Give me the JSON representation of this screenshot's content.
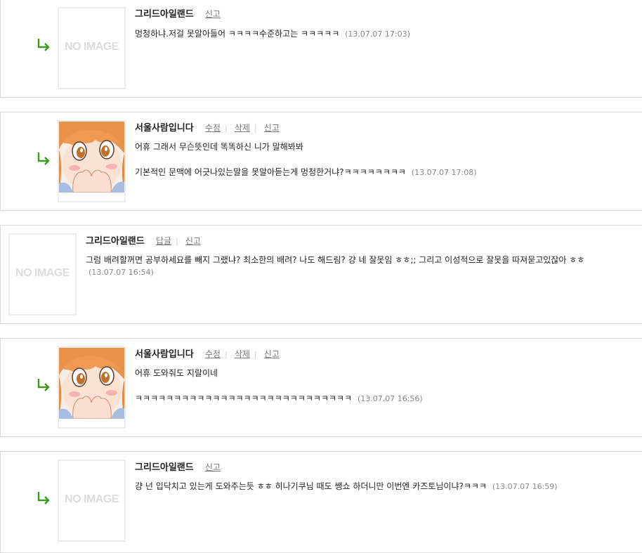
{
  "comments": [
    {
      "author": "그리드아일랜드",
      "actions": [
        "신고"
      ],
      "lines": [
        "멍청하냐.저걸 못알아들어 ㅋㅋㅋㅋ수준하고는 ㅋㅋㅋㅋㅋ"
      ],
      "timestamp": "(13.07.07 17:03)",
      "avatar": "no-image"
    },
    {
      "author": "서울사람입니다",
      "actions": [
        "수정",
        "삭제",
        "신고"
      ],
      "lines": [
        "어휴 그래서 무슨뜻인데 똑똑하신 니가 말해봐봐",
        "기본적인 문맥에 어긋나있는말을 못알아듣는게 멍청한거냐?ㅋㅋㅋㅋㅋㅋㅋㅋ"
      ],
      "timestamp": "(13.07.07 17:08)",
      "avatar": "anime-girl"
    },
    {
      "author": "그리드아일랜드",
      "actions": [
        "답글",
        "신고"
      ],
      "lines": [
        "그럼 배려할꺼면 공부하세요를 빼지 그랬냐? 최소한의 배려?  나도 해드림? 걍 네 잘못임 ㅎㅎ;; 그리고 이성적으로 잘못을 따져묻고있잖아 ㅎㅎ"
      ],
      "timestamp": "(13.07.07 16:54)",
      "avatar": "no-image"
    },
    {
      "author": "서울사람입니다",
      "actions": [
        "수정",
        "삭제",
        "신고"
      ],
      "lines": [
        "어휴 도와줘도 지랄이네",
        "ㅋㅋㅋㅋㅋㅋㅋㅋㅋㅋㅋㅋㅋㅋㅋㅋㅋㅋㅋㅋㅋㅋㅋㅋㅋㅋㅋㅋ"
      ],
      "timestamp": "(13.07.07 16:56)",
      "avatar": "anime-girl"
    },
    {
      "author": "그리드아일랜드",
      "actions": [
        "신고"
      ],
      "lines": [
        "걍 넌 입닥치고 있는게 도와주는듯 ㅎㅎ 히나기쿠님 때도 쌩쇼 하더니만 이번엔 카즈토님이냐?ㅋㅋㅋ"
      ],
      "timestamp": "(13.07.07 16:59)",
      "avatar": "no-image"
    }
  ],
  "no_image_text": "NO IMAGE",
  "icons": {
    "reply": "reply-arrow-icon"
  },
  "colors": {
    "arrow": "#3c9a1e",
    "border": "#d9d9d9",
    "timestamp": "#888888"
  }
}
